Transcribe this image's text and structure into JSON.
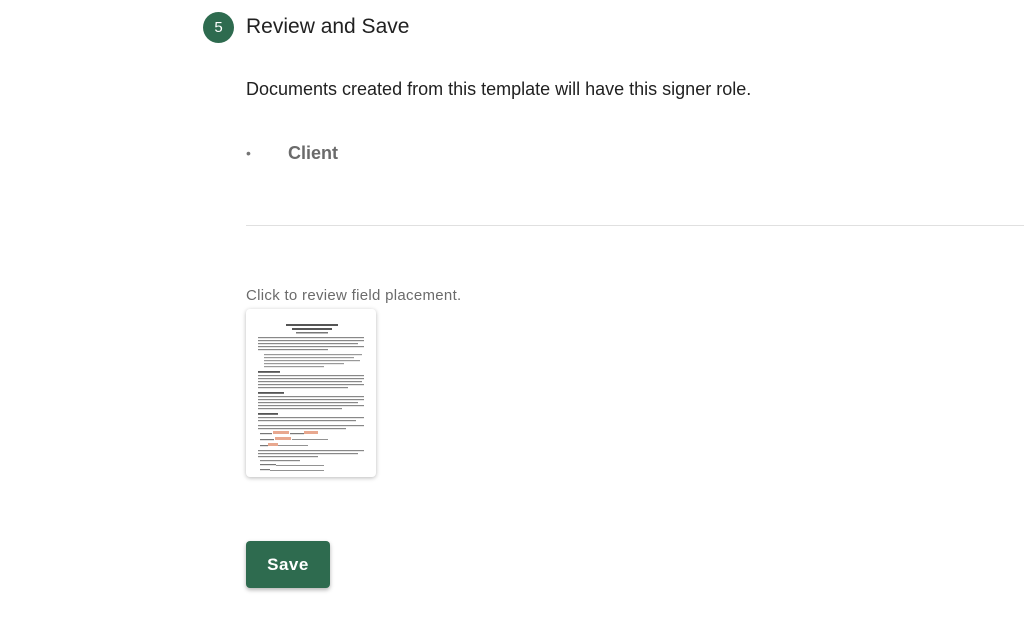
{
  "step": {
    "number": "5",
    "title": "Review and Save"
  },
  "description": "Documents created from this template will have this signer role.",
  "signers": [
    {
      "bullet": "•",
      "name": "Client"
    }
  ],
  "review": {
    "hint": "Click to review field placement."
  },
  "actions": {
    "save_label": "Save"
  },
  "colors": {
    "accent": "#2e6b4f",
    "field_highlight": "#e8a88f"
  }
}
